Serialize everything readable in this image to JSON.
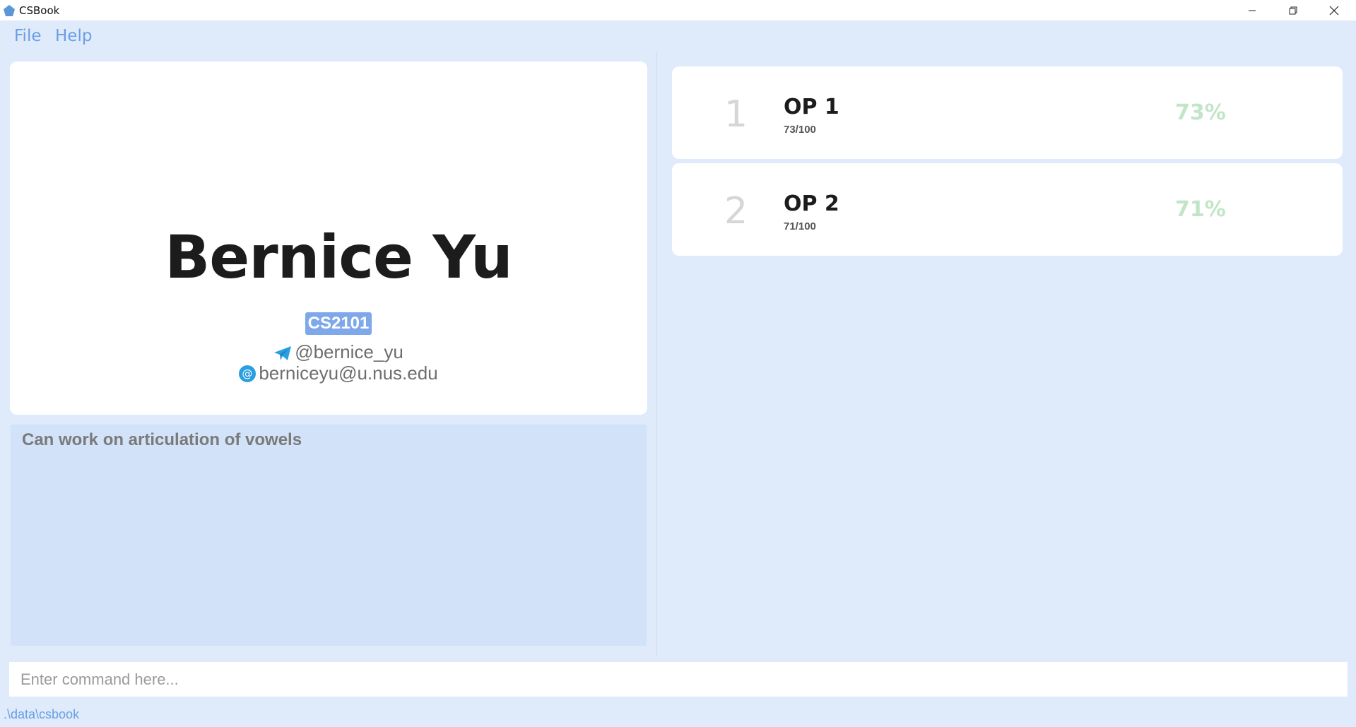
{
  "window": {
    "title": "CSBook"
  },
  "menu": {
    "file": "File",
    "help": "Help"
  },
  "person": {
    "name": "Bernice Yu",
    "tag": "CS2101",
    "telegram": "@bernice_yu",
    "email": "berniceyu@u.nus.edu",
    "note": "Can work on articulation of vowels"
  },
  "assessments": [
    {
      "index": "1",
      "name": "OP 1",
      "score": "73/100",
      "percent": "73%"
    },
    {
      "index": "2",
      "name": "OP 2",
      "score": "71/100",
      "percent": "71%"
    }
  ],
  "command": {
    "placeholder": "Enter command here..."
  },
  "status": {
    "path": ".\\data\\csbook"
  },
  "colors": {
    "background": "#dfeafa",
    "accent": "#6a9fe6",
    "tag": "#7ea8ea",
    "percent": "#c2e5c8",
    "telegram_icon": "#2a9fe0",
    "email_icon": "#2a9fe0"
  },
  "icons": {
    "app": "pentagon-icon",
    "telegram": "telegram-icon",
    "email": "at-sign-icon"
  }
}
